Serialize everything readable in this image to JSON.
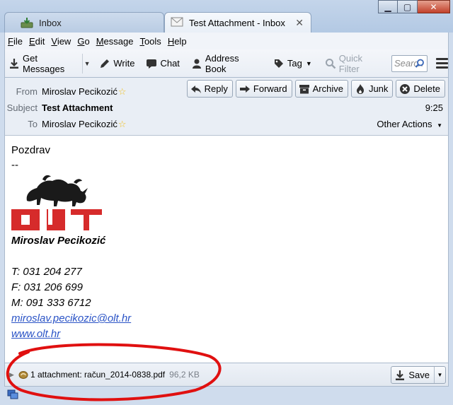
{
  "tabs": [
    {
      "label": "Inbox",
      "icon": "inbox-download-icon"
    },
    {
      "label": "Test Attachment - Inbox",
      "icon": "envelope-icon"
    }
  ],
  "menu": [
    "File",
    "Edit",
    "View",
    "Go",
    "Message",
    "Tools",
    "Help"
  ],
  "toolbar": {
    "get_messages": "Get Messages",
    "write": "Write",
    "chat": "Chat",
    "address_book": "Address Book",
    "tag": "Tag",
    "quick_filter": "Quick Filter",
    "search_placeholder": "Search"
  },
  "header": {
    "from_label": "From",
    "from_value": "Miroslav Pecikozić",
    "subject_label": "Subject",
    "subject_value": "Test Attachment",
    "to_label": "To",
    "to_value": "Miroslav Pecikozić",
    "time": "9:25",
    "other_actions": "Other Actions",
    "buttons": {
      "reply": "Reply",
      "forward": "Forward",
      "archive": "Archive",
      "junk": "Junk",
      "delete": "Delete"
    }
  },
  "body": {
    "greeting": "Pozdrav",
    "dashes": "--",
    "logo_text": "OLT",
    "signature_name": "Miroslav Pecikozić",
    "phone": "T: 031 204 277",
    "fax": "F: 031 206 699",
    "mobile": "M: 091 333 6712",
    "email": "miroslav.pecikozic@olt.hr",
    "website": "www.olt.hr"
  },
  "attachment": {
    "text": "1 attachment: račun_2014-0838.pdf",
    "size": "96,2 KB",
    "save_label": "Save"
  },
  "colors": {
    "logo_red": "#d62b2b",
    "annotation_red": "#e01010",
    "link_blue": "#2a53c6"
  }
}
